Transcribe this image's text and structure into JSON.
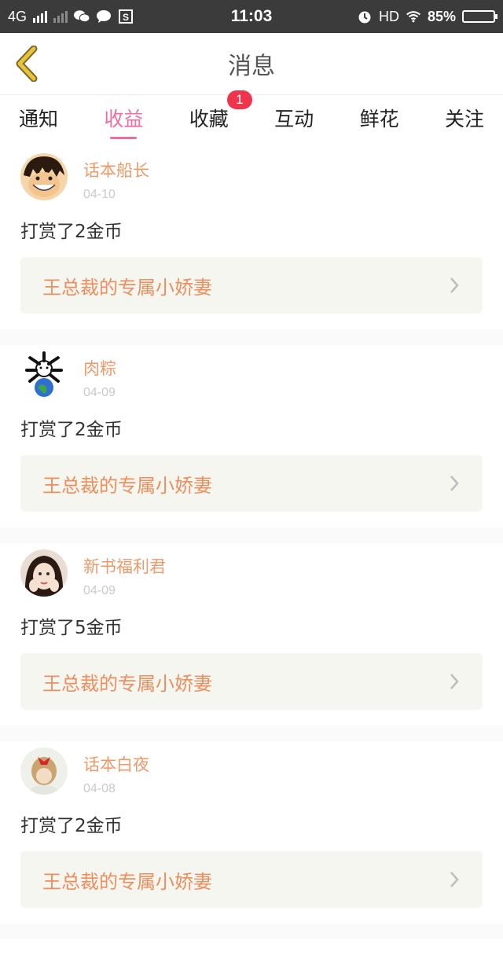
{
  "status": {
    "network": "4G",
    "time": "11:03",
    "hd": "HD",
    "battery": "85%",
    "battery_level": 0.85
  },
  "header": {
    "title": "消息"
  },
  "tabs": [
    {
      "label": "通知",
      "active": false
    },
    {
      "label": "收益",
      "active": true
    },
    {
      "label": "收藏",
      "active": false,
      "badge": "1"
    },
    {
      "label": "互动",
      "active": false
    },
    {
      "label": "鲜花",
      "active": false
    },
    {
      "label": "关注",
      "active": false
    }
  ],
  "messages": [
    {
      "user": "话本船长",
      "date": "04-10",
      "action": "打赏了2金币",
      "book": "王总裁的专属小娇妻"
    },
    {
      "user": "肉粽",
      "date": "04-09",
      "action": "打赏了2金币",
      "book": "王总裁的专属小娇妻"
    },
    {
      "user": "新书福利君",
      "date": "04-09",
      "action": "打赏了5金币",
      "book": "王总裁的专属小娇妻"
    },
    {
      "user": "话本白夜",
      "date": "04-08",
      "action": "打赏了2金币",
      "book": "王总裁的专属小娇妻"
    }
  ],
  "colors": {
    "accent": "#e96fa0",
    "name": "#ec9a6a",
    "book": "#ec8f5e",
    "badge": "#f0344d",
    "back": "#e8c23a"
  }
}
